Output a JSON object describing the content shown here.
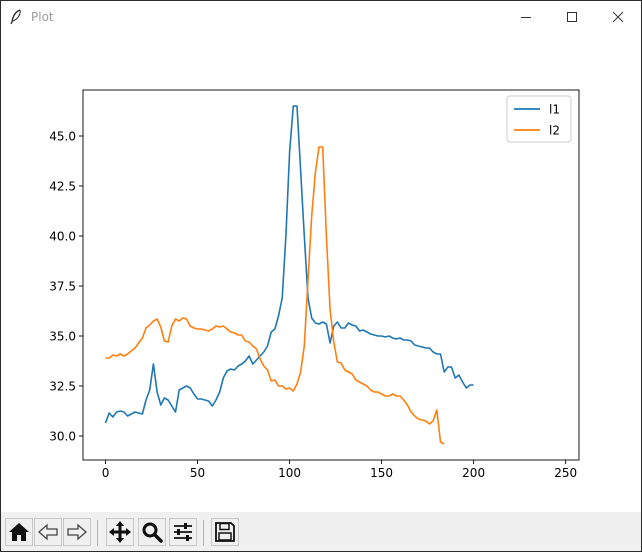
{
  "window": {
    "title": "Plot",
    "icons": {
      "app": "feather-icon",
      "minimize": "minimize-icon",
      "maximize": "maximize-icon",
      "close": "close-icon"
    }
  },
  "toolbar": {
    "buttons": [
      {
        "name": "home-button",
        "icon": "home-icon"
      },
      {
        "name": "back-button",
        "icon": "back-arrow-icon"
      },
      {
        "name": "forward-button",
        "icon": "forward-arrow-icon"
      },
      {
        "name": "pan-button",
        "icon": "move-icon"
      },
      {
        "name": "zoom-button",
        "icon": "zoom-icon"
      },
      {
        "name": "configure-subplots-button",
        "icon": "sliders-icon"
      },
      {
        "name": "save-button",
        "icon": "save-icon"
      }
    ]
  },
  "chart_data": {
    "type": "line",
    "title": "",
    "xlabel": "",
    "ylabel": "",
    "xlim": [
      -12.25,
      257.25
    ],
    "ylim": [
      28.8,
      47.3
    ],
    "xticks": [
      0,
      50,
      100,
      150,
      200,
      250
    ],
    "yticks": [
      30.0,
      32.5,
      35.0,
      37.5,
      40.0,
      42.5,
      45.0
    ],
    "xtick_labels": [
      "0",
      "50",
      "100",
      "150",
      "200",
      "250"
    ],
    "ytick_labels": [
      "30.0",
      "32.5",
      "35.0",
      "37.5",
      "40.0",
      "42.5",
      "45.0"
    ],
    "grid": false,
    "legend": "top-right",
    "series": [
      {
        "name": "l1",
        "color": "#1f77b4",
        "points": [
          [
            0,
            30.65
          ],
          [
            2,
            31.15
          ],
          [
            4,
            30.95
          ],
          [
            6,
            31.2
          ],
          [
            8,
            31.25
          ],
          [
            10,
            31.2
          ],
          [
            12,
            31.0
          ],
          [
            14,
            31.1
          ],
          [
            16,
            31.2
          ],
          [
            18,
            31.15
          ],
          [
            20,
            31.1
          ],
          [
            22,
            31.8
          ],
          [
            24,
            32.3
          ],
          [
            26,
            33.6
          ],
          [
            28,
            32.2
          ],
          [
            30,
            31.55
          ],
          [
            32,
            31.9
          ],
          [
            34,
            31.8
          ],
          [
            36,
            31.5
          ],
          [
            38,
            31.2
          ],
          [
            40,
            32.3
          ],
          [
            42,
            32.4
          ],
          [
            44,
            32.5
          ],
          [
            46,
            32.4
          ],
          [
            48,
            32.1
          ],
          [
            50,
            31.85
          ],
          [
            52,
            31.85
          ],
          [
            54,
            31.8
          ],
          [
            56,
            31.75
          ],
          [
            58,
            31.5
          ],
          [
            60,
            31.8
          ],
          [
            62,
            32.2
          ],
          [
            64,
            32.9
          ],
          [
            66,
            33.25
          ],
          [
            68,
            33.35
          ],
          [
            70,
            33.3
          ],
          [
            72,
            33.5
          ],
          [
            74,
            33.6
          ],
          [
            76,
            33.75
          ],
          [
            78,
            34.0
          ],
          [
            80,
            33.6
          ],
          [
            82,
            33.8
          ],
          [
            84,
            34.0
          ],
          [
            86,
            34.2
          ],
          [
            88,
            34.5
          ],
          [
            90,
            35.2
          ],
          [
            92,
            35.35
          ],
          [
            94,
            36.0
          ],
          [
            96,
            36.9
          ],
          [
            98,
            40.0
          ],
          [
            100,
            44.2
          ],
          [
            102,
            46.5
          ],
          [
            104,
            46.5
          ],
          [
            106,
            43.3
          ],
          [
            108,
            40.0
          ],
          [
            110,
            36.9
          ],
          [
            112,
            35.9
          ],
          [
            114,
            35.65
          ],
          [
            116,
            35.6
          ],
          [
            118,
            35.7
          ],
          [
            120,
            35.6
          ],
          [
            122,
            34.65
          ],
          [
            124,
            35.5
          ],
          [
            126,
            35.7
          ],
          [
            128,
            35.4
          ],
          [
            130,
            35.4
          ],
          [
            132,
            35.65
          ],
          [
            134,
            35.55
          ],
          [
            136,
            35.5
          ],
          [
            138,
            35.25
          ],
          [
            140,
            35.3
          ],
          [
            142,
            35.2
          ],
          [
            144,
            35.1
          ],
          [
            146,
            35.05
          ],
          [
            148,
            35.0
          ],
          [
            150,
            35.0
          ],
          [
            152,
            34.95
          ],
          [
            154,
            35.0
          ],
          [
            156,
            34.9
          ],
          [
            158,
            34.85
          ],
          [
            160,
            34.9
          ],
          [
            162,
            34.8
          ],
          [
            164,
            34.8
          ],
          [
            166,
            34.75
          ],
          [
            168,
            34.55
          ],
          [
            170,
            34.5
          ],
          [
            172,
            34.45
          ],
          [
            174,
            34.4
          ],
          [
            176,
            34.4
          ],
          [
            178,
            34.2
          ],
          [
            180,
            34.1
          ],
          [
            182,
            34.1
          ],
          [
            184,
            33.2
          ],
          [
            186,
            33.45
          ],
          [
            188,
            33.45
          ],
          [
            190,
            32.9
          ],
          [
            192,
            33.05
          ],
          [
            194,
            32.7
          ],
          [
            196,
            32.4
          ],
          [
            198,
            32.55
          ],
          [
            200,
            32.55
          ]
        ]
      },
      {
        "name": "l2",
        "color": "#ff7f0e",
        "points": [
          [
            0,
            33.9
          ],
          [
            2,
            33.9
          ],
          [
            4,
            34.05
          ],
          [
            6,
            34.0
          ],
          [
            8,
            34.1
          ],
          [
            10,
            34.0
          ],
          [
            12,
            34.1
          ],
          [
            14,
            34.25
          ],
          [
            16,
            34.4
          ],
          [
            18,
            34.65
          ],
          [
            20,
            34.9
          ],
          [
            22,
            35.4
          ],
          [
            24,
            35.55
          ],
          [
            26,
            35.75
          ],
          [
            28,
            35.85
          ],
          [
            30,
            35.45
          ],
          [
            32,
            34.75
          ],
          [
            34,
            34.7
          ],
          [
            36,
            35.5
          ],
          [
            38,
            35.85
          ],
          [
            40,
            35.75
          ],
          [
            42,
            35.9
          ],
          [
            44,
            35.85
          ],
          [
            46,
            35.5
          ],
          [
            48,
            35.4
          ],
          [
            50,
            35.35
          ],
          [
            52,
            35.35
          ],
          [
            54,
            35.3
          ],
          [
            56,
            35.25
          ],
          [
            58,
            35.35
          ],
          [
            60,
            35.5
          ],
          [
            62,
            35.45
          ],
          [
            64,
            35.5
          ],
          [
            66,
            35.35
          ],
          [
            68,
            35.2
          ],
          [
            70,
            35.15
          ],
          [
            72,
            35.05
          ],
          [
            74,
            35.05
          ],
          [
            76,
            34.75
          ],
          [
            78,
            34.7
          ],
          [
            80,
            34.5
          ],
          [
            82,
            34.35
          ],
          [
            84,
            33.85
          ],
          [
            86,
            33.5
          ],
          [
            88,
            33.3
          ],
          [
            90,
            32.75
          ],
          [
            92,
            32.8
          ],
          [
            94,
            32.5
          ],
          [
            96,
            32.5
          ],
          [
            98,
            32.35
          ],
          [
            100,
            32.4
          ],
          [
            102,
            32.25
          ],
          [
            104,
            32.6
          ],
          [
            106,
            33.2
          ],
          [
            108,
            34.5
          ],
          [
            110,
            37.8
          ],
          [
            112,
            41.0
          ],
          [
            114,
            43.2
          ],
          [
            116,
            44.45
          ],
          [
            118,
            44.45
          ],
          [
            120,
            40.0
          ],
          [
            122,
            36.3
          ],
          [
            124,
            34.7
          ],
          [
            126,
            33.7
          ],
          [
            128,
            33.65
          ],
          [
            130,
            33.3
          ],
          [
            132,
            33.2
          ],
          [
            134,
            33.1
          ],
          [
            136,
            32.8
          ],
          [
            138,
            32.7
          ],
          [
            140,
            32.6
          ],
          [
            142,
            32.5
          ],
          [
            144,
            32.3
          ],
          [
            146,
            32.2
          ],
          [
            148,
            32.2
          ],
          [
            150,
            32.1
          ],
          [
            152,
            32.0
          ],
          [
            154,
            32.0
          ],
          [
            156,
            32.1
          ],
          [
            158,
            32.0
          ],
          [
            160,
            32.0
          ],
          [
            162,
            31.8
          ],
          [
            164,
            31.55
          ],
          [
            166,
            31.2
          ],
          [
            168,
            31.0
          ],
          [
            170,
            30.85
          ],
          [
            172,
            30.8
          ],
          [
            174,
            30.75
          ],
          [
            176,
            30.6
          ],
          [
            178,
            30.75
          ],
          [
            180,
            31.3
          ],
          [
            182,
            29.7
          ],
          [
            184,
            29.6
          ]
        ]
      }
    ]
  }
}
